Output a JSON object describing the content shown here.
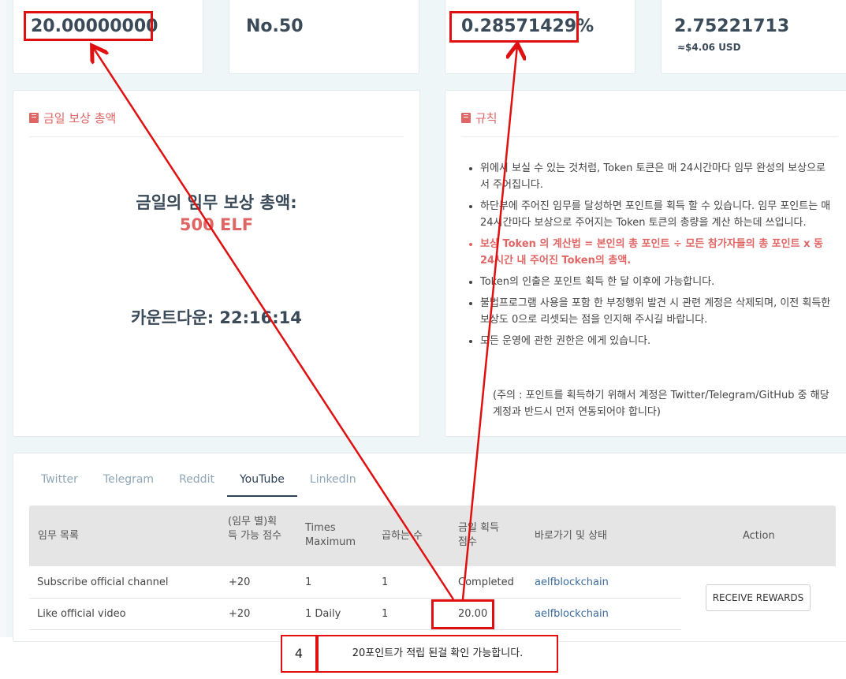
{
  "stats": [
    {
      "value": "20.00000000"
    },
    {
      "value": "No.50"
    },
    {
      "value": "0.28571429%"
    },
    {
      "value": "2.75221713",
      "sub": "≈$4.06 USD"
    }
  ],
  "reward_panel": {
    "title": "금일 보상 총액",
    "total_label": "금일의 임무 보상 총액:",
    "total_value": "500 ELF",
    "countdown": "카운트다운: 22:16:14"
  },
  "rules_panel": {
    "title": "규칙",
    "items": [
      "위에서 보실 수 있는 것처럼, Token 토큰은 매 24시간마다 임무 완성의 보상으로서 주어집니다.",
      "하단부에 주어진 임무를 달성하면 포인트를 획득 할 수 있습니다. 임무 포인트는 매 24시간마다 보상으로 주어지는 Token 토큰의 총량을 계산 하는데 쓰입니다.",
      "보상 Token 의 계산법 = 본인의 총 포인트 ÷ 모든 참가자들의 총 포인트 x 동 24시간 내 주어진 Token의 총액.",
      "Token의 인출은 포인트 획득 한 달 이후에 가능합니다.",
      "불법프로그램 사용을 포함 한 부정행위 발견 시 관련 계정은 삭제되며, 이전 획득한 보상도 0으로 리셋되는 점을 인지해 주시길 바랍니다.",
      "모든 운영에 관한 권한은 에게 있습니다."
    ],
    "note": "(주의 : 포인트를 획득하기 위해서 계정은 Twitter/Telegram/GitHub 중 해당 계정과 반드시 먼저 연동되어야 합니다)"
  },
  "tabs": [
    {
      "label": "Twitter",
      "active": false
    },
    {
      "label": "Telegram",
      "active": false
    },
    {
      "label": "Reddit",
      "active": false
    },
    {
      "label": "YouTube",
      "active": true
    },
    {
      "label": "LinkedIn",
      "active": false
    }
  ],
  "table": {
    "headers": {
      "task": "임무 목록",
      "points": "(임무 별)획득 가능 점수",
      "times": "Times Maximum",
      "multiplier": "곱하는 수",
      "today": "금일 획득 점수",
      "link_status": "바로가기 및 상태",
      "action": "Action"
    },
    "rows": [
      {
        "task": "Subscribe official channel",
        "points": "+20",
        "times": "1",
        "multiplier": "1",
        "today": "Completed",
        "link": "aelfblockchain"
      },
      {
        "task": "Like official video",
        "points": "+20",
        "times": "1 Daily",
        "multiplier": "1",
        "today": "20.00",
        "link": "aelfblockchain"
      }
    ],
    "action_button": "RECEIVE REWARDS"
  },
  "callout": {
    "number": "4",
    "text": "20포인트가 적립 된걸 확인 가능합니다."
  },
  "colors": {
    "accent_red": "#e06666",
    "annotation_red": "#e01010",
    "link_blue": "#3b6b9c",
    "active_tab": "#2d4357"
  }
}
